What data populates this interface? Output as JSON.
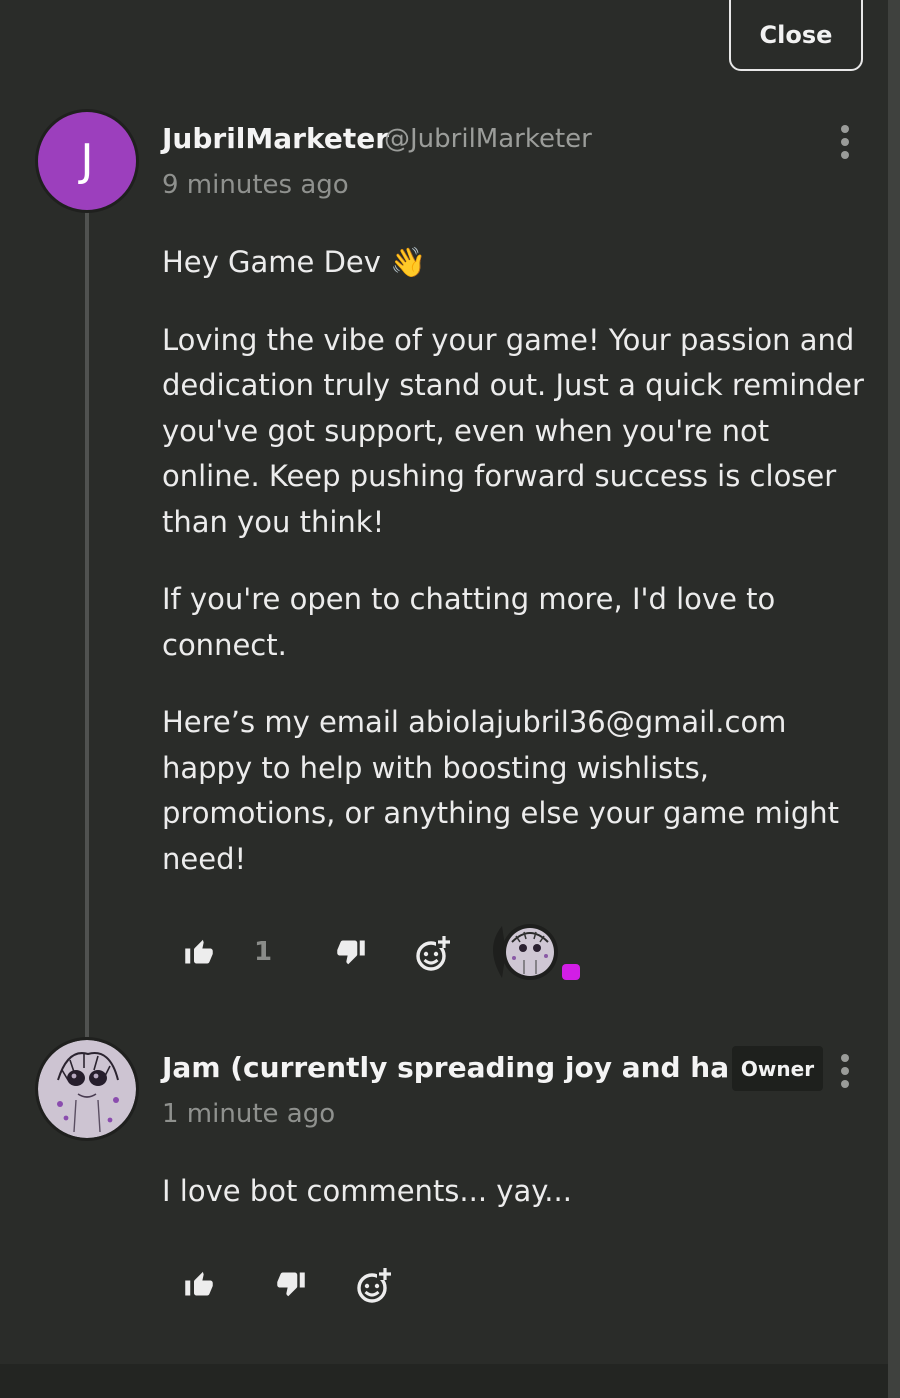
{
  "close_label": "Close",
  "comments": [
    {
      "avatar_letter": "J",
      "avatar_color": "#9c3fbd",
      "author": "JubrilMarketer",
      "handle": "@JubrilMarketer",
      "timestamp": "9 minutes ago",
      "greeting": "Hey Game Dev 👋",
      "paragraphs": [
        "Loving the vibe of your game! Your passion and dedication truly stand out. Just a quick reminder you've got support, even when you're not online. Keep pushing forward success is closer than you think!",
        "If you're open to chatting more, I'd love to connect.",
        "Here’s my  email  abiolajubril36@gmail.com happy to help with boosting wishlists, promotions, or anything else your game might need!"
      ],
      "like_count": "1",
      "icons": [
        "thumbs-up-icon",
        "thumbs-down-icon",
        "add-reaction-icon",
        "more-vertical-icon"
      ]
    },
    {
      "author": "Jam (currently spreading joy and ha...",
      "badge": "Owner",
      "timestamp": "1 minute ago",
      "body": "I love bot comments... yay...",
      "icons": [
        "thumbs-up-icon",
        "thumbs-down-icon",
        "add-reaction-icon",
        "more-vertical-icon"
      ]
    }
  ],
  "colors": {
    "background": "#2a2c29",
    "accent_purple": "#9c3fbd",
    "reaction_dot": "#d21ee6"
  }
}
